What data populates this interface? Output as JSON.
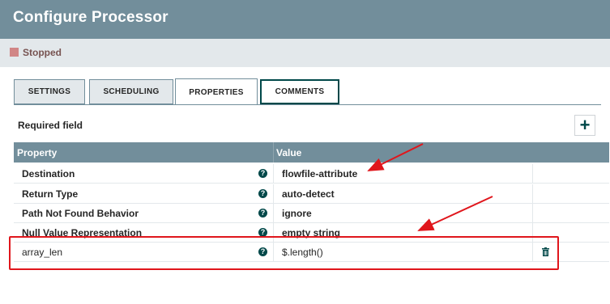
{
  "dialog": {
    "title": "Configure Processor"
  },
  "status": {
    "text": "Stopped",
    "color": "#d18686"
  },
  "tabs": [
    {
      "label": "SETTINGS",
      "selected": false
    },
    {
      "label": "SCHEDULING",
      "selected": false
    },
    {
      "label": "PROPERTIES",
      "selected": true
    },
    {
      "label": "COMMENTS",
      "selected": false
    }
  ],
  "properties": {
    "required_label": "Required field",
    "columns": {
      "property": "Property",
      "value": "Value"
    },
    "rows": [
      {
        "name": "Destination",
        "value": "flowfile-attribute",
        "required": true
      },
      {
        "name": "Return Type",
        "value": "auto-detect",
        "required": true
      },
      {
        "name": "Path Not Found Behavior",
        "value": "ignore",
        "required": true
      },
      {
        "name": "Null Value Representation",
        "value": "empty string",
        "required": true
      },
      {
        "name": "array_len",
        "value": "$.length()",
        "required": false
      }
    ]
  },
  "colors": {
    "header": "#728e9b",
    "accent": "#004849",
    "annotation": "#e0161c"
  }
}
